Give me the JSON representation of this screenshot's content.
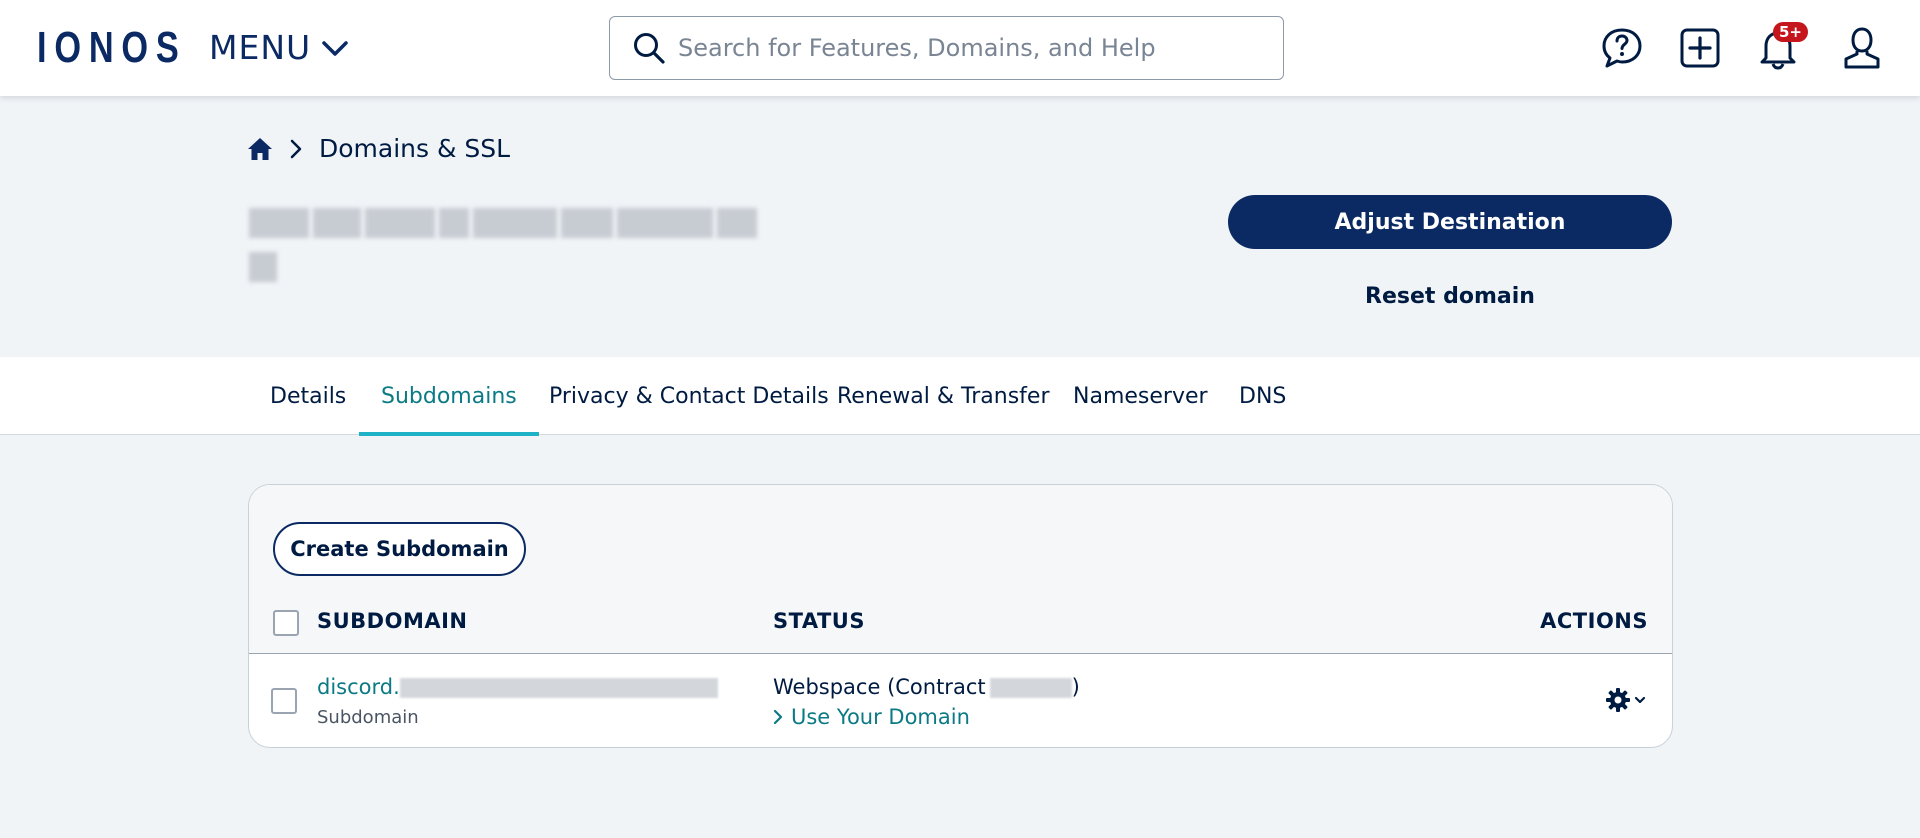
{
  "topbar": {
    "logo": "IONOS",
    "menu_label": "MENU",
    "search_placeholder": "Search for Features, Domains, and Help",
    "notification_badge": "5+"
  },
  "breadcrumb": {
    "current": "Domains & SSL"
  },
  "header": {
    "adjust_destination": "Adjust Destination",
    "reset_domain": "Reset domain"
  },
  "tabs": [
    {
      "label": "Details"
    },
    {
      "label": "Subdomains"
    },
    {
      "label": "Privacy & Contact Details"
    },
    {
      "label": "Renewal & Transfer"
    },
    {
      "label": "Nameserver"
    },
    {
      "label": "DNS"
    }
  ],
  "card": {
    "create_button": "Create Subdomain",
    "columns": {
      "subdomain": "SUBDOMAIN",
      "status": "STATUS",
      "actions": "ACTIONS"
    },
    "rows": [
      {
        "name_prefix": "discord.",
        "type": "Subdomain",
        "status_prefix": "Webspace (Contract",
        "status_suffix": ")",
        "status_link": "Use Your Domain"
      }
    ]
  },
  "colors": {
    "brand_navy": "#0b2a63",
    "accent_teal": "#0b7a85",
    "tab_underline": "#1fb2c6",
    "badge_red": "#c4161c",
    "page_bg": "#f0f4f7"
  }
}
